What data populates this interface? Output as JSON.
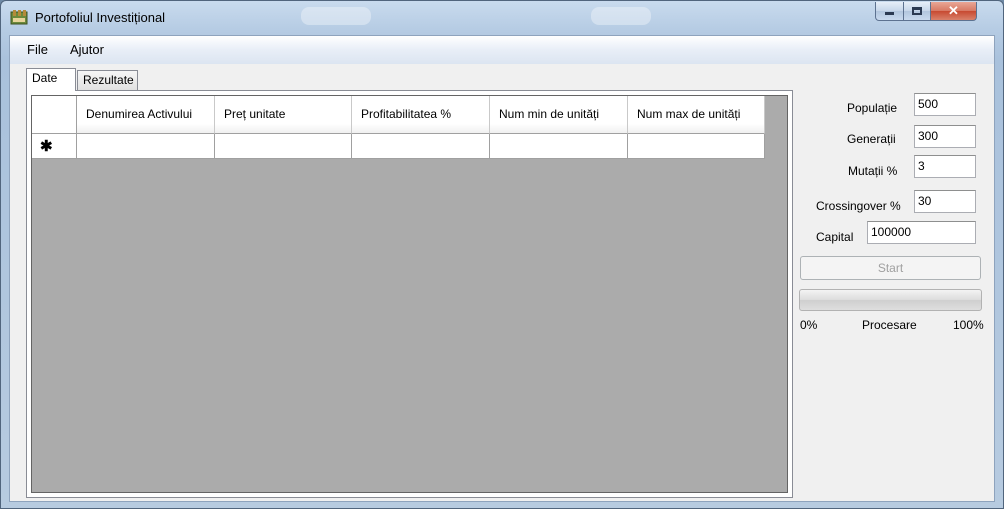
{
  "window": {
    "title": "Portofoliul Investițional",
    "buttons": {
      "minimize": "",
      "maximize": "",
      "close": "✕"
    }
  },
  "menu": {
    "file": "File",
    "help": "Ajutor"
  },
  "tabs": [
    {
      "label": "Date",
      "active": true
    },
    {
      "label": "Rezultate",
      "active": false
    }
  ],
  "grid": {
    "columns": [
      "Denumirea Activului",
      "Preț unitate",
      "Profitabilitatea %",
      "Num min de unități",
      "Num max de unități"
    ],
    "new_row_marker": "✱",
    "rows": [
      [
        "",
        "",
        "",
        "",
        ""
      ]
    ]
  },
  "params": {
    "populatie": {
      "label": "Populație",
      "value": "500"
    },
    "generatii": {
      "label": "Generații",
      "value": "300"
    },
    "mutatii": {
      "label": "Mutații %",
      "value": "3"
    },
    "crossingover": {
      "label": "Crossingover %",
      "value": "30"
    },
    "capital": {
      "label": "Capital",
      "value": "100000"
    }
  },
  "start_label": "Start",
  "progress": {
    "value": 0,
    "min_label": "0%",
    "center_label": "Procesare",
    "max_label": "100%"
  },
  "colors": {
    "grid_background": "#ababab",
    "start_disabled_text": "#a0a0a0"
  }
}
